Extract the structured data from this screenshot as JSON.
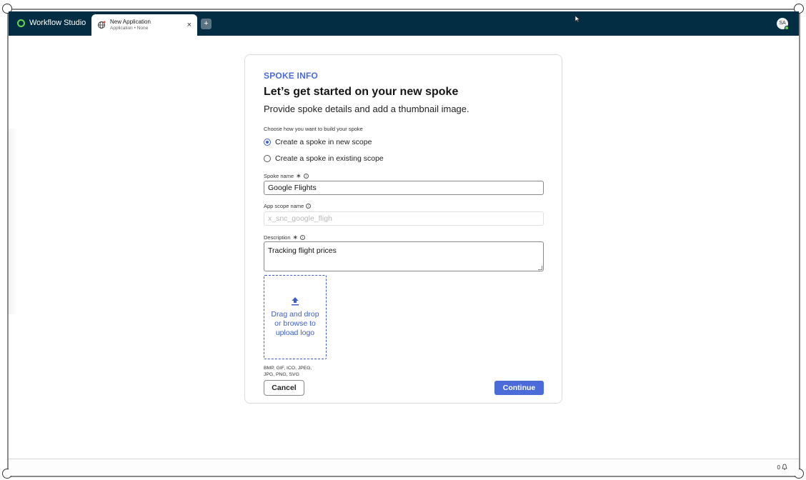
{
  "app": {
    "brand": "Workflow Studio"
  },
  "tab": {
    "title": "New Application",
    "subtitle": "Application • None",
    "close": "×"
  },
  "add_tab": "+",
  "user": {
    "initials": "SA"
  },
  "card": {
    "eyebrow": "SPOKE INFO",
    "heading": "Let’s get started on your new spoke",
    "subheading": "Provide spoke details and add a thumbnail image.",
    "build_prompt": "Choose how you want to build your spoke",
    "options": [
      {
        "label": "Create a spoke in new scope",
        "checked": true
      },
      {
        "label": "Create a spoke in existing scope",
        "checked": false
      }
    ],
    "spoke_name": {
      "label": "Spoke name",
      "required_mark": "∗",
      "value": "Google Flights"
    },
    "app_scope": {
      "label": "App scope name",
      "value": "x_snc_google_fligh"
    },
    "description": {
      "label": "Description",
      "required_mark": "∗",
      "value": "Tracking flight prices"
    },
    "upload": {
      "line1": "Drag and drop",
      "line2": "or browse to",
      "line3": "upload logo"
    },
    "formats": "BMP, GIF, ICO, JPEG, JPG, PNG, SVG",
    "cancel_label": "Cancel",
    "continue_label": "Continue"
  },
  "footer": {
    "count": "0"
  },
  "colors": {
    "topbar": "#032d42",
    "accent": "#4a6bd8",
    "brand_green": "#62d84e"
  },
  "icons": [
    "workflow-studio-logo-icon",
    "globe-icon",
    "close-icon",
    "plus-icon",
    "info-icon",
    "upload-icon",
    "bell-icon",
    "cursor-icon"
  ]
}
